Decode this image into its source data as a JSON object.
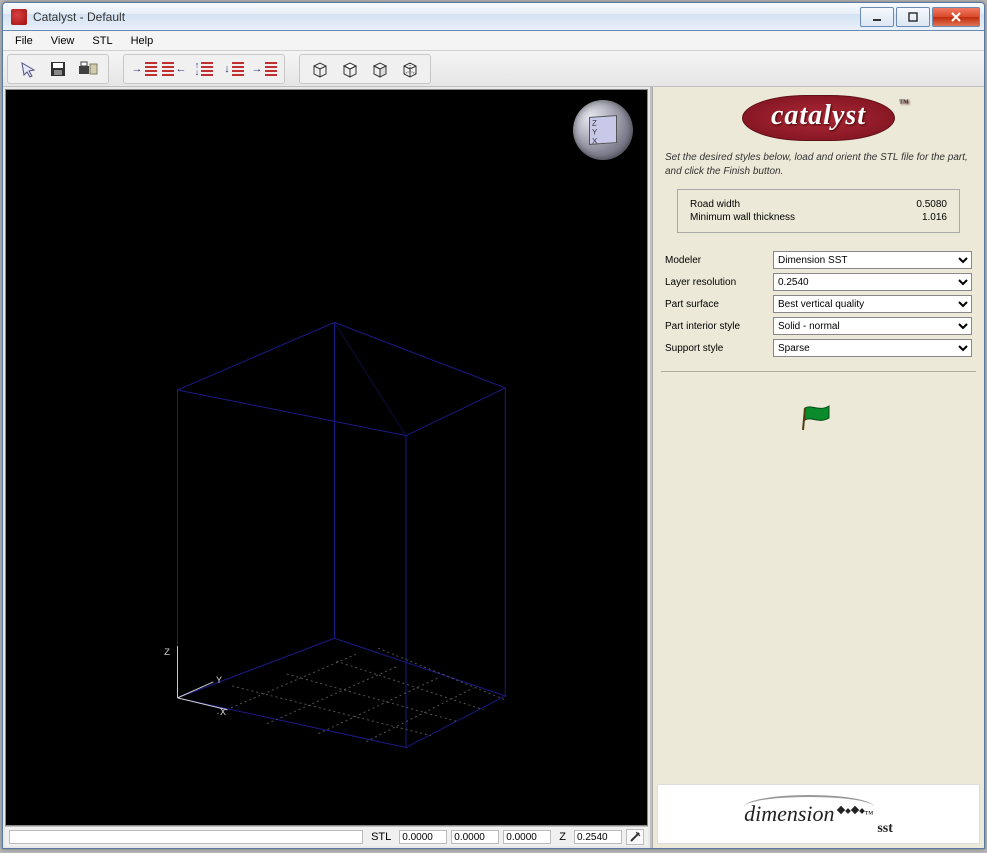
{
  "titlebar": {
    "title": "Catalyst - Default"
  },
  "menu": {
    "file": "File",
    "view": "View",
    "stl": "STL",
    "help": "Help"
  },
  "instructions": "Set the desired styles below, load and orient the STL file for the part, and click the Finish button.",
  "info": {
    "road_width_label": "Road width",
    "road_width_value": "0.5080",
    "min_wall_label": "Minimum wall thickness",
    "min_wall_value": "1.016"
  },
  "form": {
    "modeler_label": "Modeler",
    "modeler_value": "Dimension SST",
    "layer_label": "Layer resolution",
    "layer_value": "0.2540",
    "surface_label": "Part surface",
    "surface_value": "Best vertical quality",
    "interior_label": "Part interior style",
    "interior_value": "Solid - normal",
    "support_label": "Support style",
    "support_value": "Sparse"
  },
  "status": {
    "stl_label": "STL",
    "x": "0.0000",
    "y": "0.0000",
    "z": "0.0000",
    "z_label": "Z",
    "zval": "0.2540"
  },
  "axes": {
    "x": "X",
    "y": "Y",
    "z": "Z"
  },
  "gizmo": {
    "z": "Z",
    "y": "Y",
    "x": "X"
  },
  "brand": {
    "top": "catalyst",
    "bottom": "dimension",
    "sst": "sst"
  }
}
